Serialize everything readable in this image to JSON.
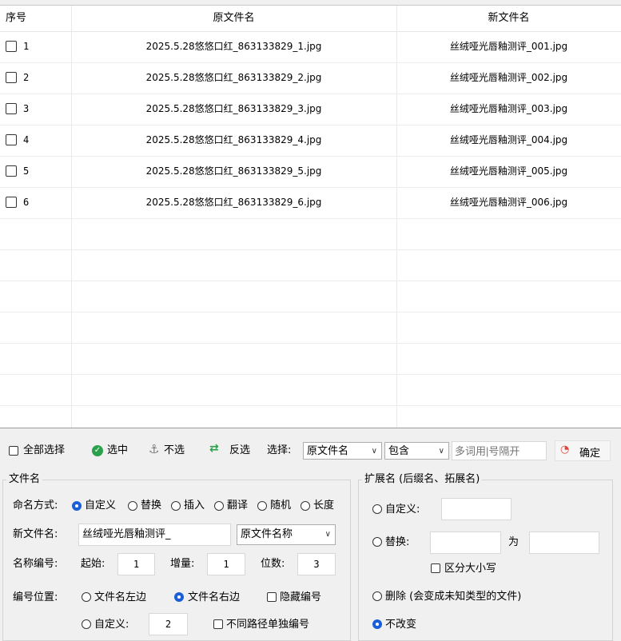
{
  "table": {
    "columns": [
      "序号",
      "原文件名",
      "新文件名"
    ],
    "rows": [
      {
        "index": "1",
        "original": "2025.5.28悠悠口红_863133829_1.jpg",
        "new": "丝绒哑光唇釉测评_001.jpg"
      },
      {
        "index": "2",
        "original": "2025.5.28悠悠口红_863133829_2.jpg",
        "new": "丝绒哑光唇釉测评_002.jpg"
      },
      {
        "index": "3",
        "original": "2025.5.28悠悠口红_863133829_3.jpg",
        "new": "丝绒哑光唇釉测评_003.jpg"
      },
      {
        "index": "4",
        "original": "2025.5.28悠悠口红_863133829_4.jpg",
        "new": "丝绒哑光唇釉测评_004.jpg"
      },
      {
        "index": "5",
        "original": "2025.5.28悠悠口红_863133829_5.jpg",
        "new": "丝绒哑光唇釉测评_005.jpg"
      },
      {
        "index": "6",
        "original": "2025.5.28悠悠口红_863133829_6.jpg",
        "new": "丝绒哑光唇釉测评_006.jpg"
      }
    ]
  },
  "toolbar": {
    "select_all": "全部选择",
    "select": "选中",
    "unselect": "不选",
    "invert": "反选",
    "choose_label": "选择:",
    "field_value": "原文件名",
    "match_value": "包含",
    "keyword_placeholder": "多词用|号隔开",
    "confirm": "确定"
  },
  "filename": {
    "title": "文件名",
    "mode_label": "命名方式:",
    "modes": [
      "自定义",
      "替换",
      "插入",
      "翻译",
      "随机",
      "长度"
    ],
    "mode_selected": "自定义",
    "new_name_label": "新文件名:",
    "new_name_value": "丝绒哑光唇釉测评_",
    "new_name_source": "原文件名称",
    "numbering_label": "名称编号:",
    "start_label": "起始:",
    "start_value": "1",
    "step_label": "增量:",
    "step_value": "1",
    "digits_label": "位数:",
    "digits_value": "3",
    "position_label": "编号位置:",
    "pos_left": "文件名左边",
    "pos_right": "文件名右边",
    "pos_selected": "文件名右边",
    "hide_number": "隐藏编号",
    "custom_label": "自定义:",
    "custom_value": "2",
    "separate_numbering": "不同路径单独编号"
  },
  "extension": {
    "title": "扩展名 (后缀名、拓展名)",
    "custom": "自定义:",
    "replace": "替换:",
    "to": "为",
    "case_sensitive": "区分大小写",
    "delete": "删除 (会变成未知类型的文件)",
    "unchanged": "不改变",
    "selected": "不改变"
  },
  "colors": {
    "accent": "#1a5fd8",
    "check_green": "#2aa14a",
    "confirm_red": "#e0453a"
  }
}
